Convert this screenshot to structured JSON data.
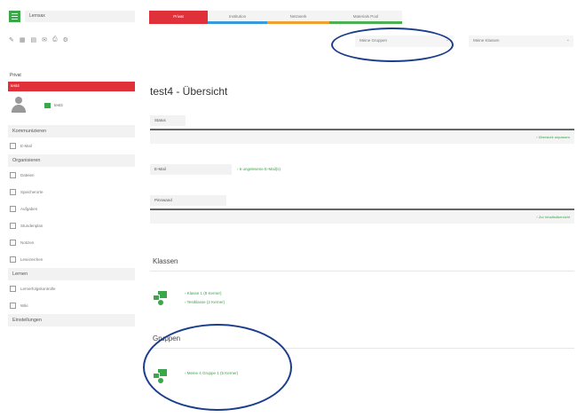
{
  "header": {
    "brand": "Lernsax",
    "tabs": [
      {
        "label": "Privat",
        "active": true
      },
      {
        "label": "Institution",
        "active": false
      },
      {
        "label": "Netzwerk",
        "active": false
      },
      {
        "label": "Materials Pool",
        "active": false
      }
    ]
  },
  "toolbar": {
    "icons": [
      "✎",
      "▦",
      "▤",
      "✉",
      "⎙",
      "⚙"
    ],
    "select_groups": "Meine Gruppen",
    "select_classes": "Meine Klassen",
    "chevron": "⌄"
  },
  "sidebar": {
    "heading": "Privat",
    "active_item": "test4",
    "profile_name": "test4",
    "sections": [
      {
        "title": "Kommunizieren",
        "items": [
          "E-Mail"
        ]
      },
      {
        "title": "Organisieren",
        "items": [
          "Dateien",
          "Speicherorte",
          "Aufgaben",
          "Stundenplan",
          "Notizen",
          "Lesezeichen"
        ]
      },
      {
        "title": "Lernen",
        "items": [
          "Lernerfolgskontrolle",
          "Wiki"
        ]
      },
      {
        "title": "Einstellungen",
        "items": []
      }
    ]
  },
  "main": {
    "title": "test4 - Übersicht",
    "status_label": "Status",
    "status_link": "› Übersicht anpassen",
    "email_label": "E-Mail",
    "email_value": "› 6 ungelesene E-Mail(s)",
    "pinnwand_label": "Pinnwand",
    "pinnwand_link": "› Zur Inhaltsübersicht",
    "classes_heading": "Klassen",
    "classes": [
      "› Klasse 1 (8 Kerner)",
      "› Testklasse (2 Kerner)"
    ],
    "groups_heading": "Gruppen",
    "groups": [
      "› Meine 4 Gruppe 1 (5 Kerner)"
    ]
  },
  "colors": {
    "accent_red": "#e0303a",
    "accent_green": "#3ba64a",
    "annotation_blue": "#1b3d8c"
  }
}
